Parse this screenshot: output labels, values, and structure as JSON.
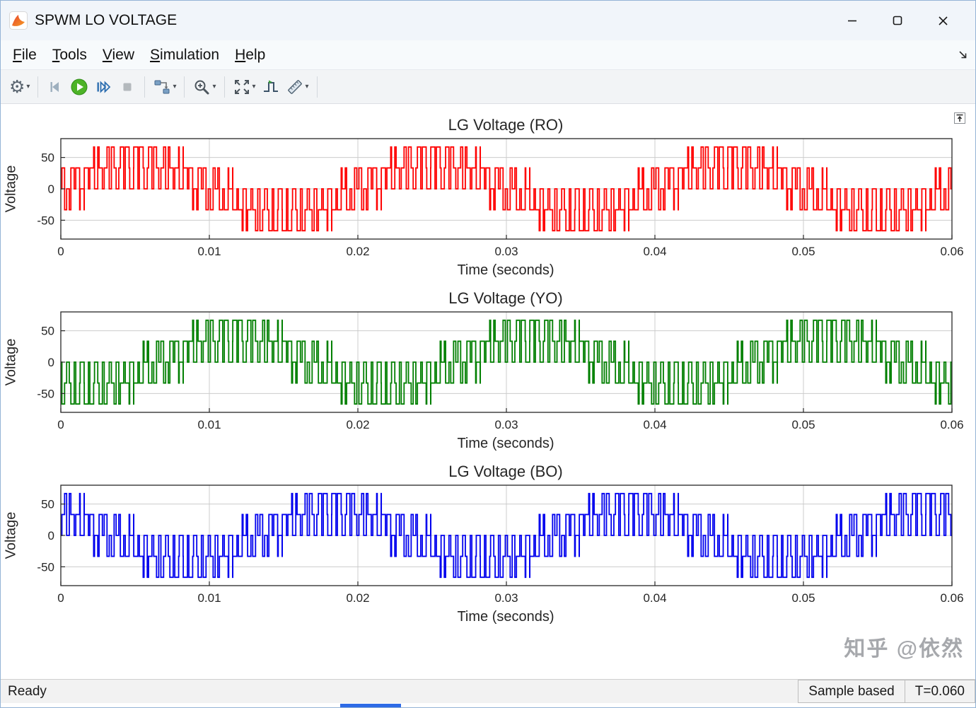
{
  "window": {
    "title": "SPWM LO VOLTAGE",
    "app_icon": "matlab-logo-icon",
    "controls": [
      "minimize",
      "maximize",
      "close"
    ]
  },
  "menu": {
    "items": [
      "File",
      "Tools",
      "View",
      "Simulation",
      "Help"
    ],
    "dock_arrow_icon": "dock-arrow-icon"
  },
  "toolbar": {
    "buttons": [
      {
        "name": "settings",
        "icon": "gear-icon",
        "dropdown": true
      },
      {
        "name": "step-back",
        "icon": "step-back-icon",
        "dropdown": false
      },
      {
        "name": "run",
        "icon": "run-icon",
        "dropdown": false
      },
      {
        "name": "step-forward",
        "icon": "step-forward-icon",
        "dropdown": false
      },
      {
        "name": "stop",
        "icon": "stop-icon",
        "dropdown": false
      },
      {
        "name": "simulink-blocks",
        "icon": "blocks-icon",
        "dropdown": true
      },
      {
        "name": "zoom",
        "icon": "zoom-icon",
        "dropdown": true
      },
      {
        "name": "fit-to-view",
        "icon": "fit-to-view-icon",
        "dropdown": true
      },
      {
        "name": "trigger",
        "icon": "trigger-icon",
        "dropdown": false
      },
      {
        "name": "measurements",
        "icon": "ruler-icon",
        "dropdown": true
      }
    ]
  },
  "canvas": {
    "expand_icon": "dock-up-icon"
  },
  "chart_data": [
    {
      "type": "line",
      "title": "LG Voltage (RO)",
      "xlabel": "Time (seconds)",
      "ylabel": "Voltage",
      "color": "#ff0000",
      "color_name": "red",
      "grid_color": "#cccccc",
      "grid": true,
      "xlim": [
        0,
        0.06
      ],
      "ylim": [
        -80,
        80
      ],
      "x_ticks": [
        0,
        0.01,
        0.02,
        0.03,
        0.04,
        0.05,
        0.06
      ],
      "x_tick_labels": [
        "0",
        "0.01",
        "0.02",
        "0.03",
        "0.04",
        "0.05",
        "0.06"
      ],
      "y_ticks": [
        -50,
        0,
        50
      ],
      "y_tick_labels": [
        "-50",
        "0",
        "50"
      ],
      "waveform": {
        "kind": "spwm_line_to_ground",
        "phase_deg": 0,
        "fundamental_hz": 50,
        "carrier_hz": 1050,
        "modulation_index": 0.8,
        "vdc": 100,
        "levels_volts": [
          -66.67,
          -33.33,
          0,
          33.33,
          66.67
        ]
      }
    },
    {
      "type": "line",
      "title": "LG Voltage (YO)",
      "xlabel": "Time (seconds)",
      "ylabel": "Voltage",
      "color": "#007f00",
      "color_name": "green",
      "grid_color": "#cccccc",
      "grid": true,
      "xlim": [
        0,
        0.06
      ],
      "ylim": [
        -80,
        80
      ],
      "x_ticks": [
        0,
        0.01,
        0.02,
        0.03,
        0.04,
        0.05,
        0.06
      ],
      "x_tick_labels": [
        "0",
        "0.01",
        "0.02",
        "0.03",
        "0.04",
        "0.05",
        "0.06"
      ],
      "y_ticks": [
        -50,
        0,
        50
      ],
      "y_tick_labels": [
        "-50",
        "0",
        "50"
      ],
      "waveform": {
        "kind": "spwm_line_to_ground",
        "phase_deg": -120,
        "fundamental_hz": 50,
        "carrier_hz": 1050,
        "modulation_index": 0.8,
        "vdc": 100,
        "levels_volts": [
          -66.67,
          -33.33,
          0,
          33.33,
          66.67
        ]
      }
    },
    {
      "type": "line",
      "title": "LG Voltage (BO)",
      "xlabel": "Time (seconds)",
      "ylabel": "Voltage",
      "color": "#0000ee",
      "color_name": "blue",
      "grid_color": "#cccccc",
      "grid": true,
      "xlim": [
        0,
        0.06
      ],
      "ylim": [
        -80,
        80
      ],
      "x_ticks": [
        0,
        0.01,
        0.02,
        0.03,
        0.04,
        0.05,
        0.06
      ],
      "x_tick_labels": [
        "0",
        "0.01",
        "0.02",
        "0.03",
        "0.04",
        "0.05",
        "0.06"
      ],
      "y_ticks": [
        -50,
        0,
        50
      ],
      "y_tick_labels": [
        "-50",
        "0",
        "50"
      ],
      "waveform": {
        "kind": "spwm_line_to_ground",
        "phase_deg": -240,
        "fundamental_hz": 50,
        "carrier_hz": 1050,
        "modulation_index": 0.8,
        "vdc": 100,
        "levels_volts": [
          -66.67,
          -33.33,
          0,
          33.33,
          66.67
        ]
      }
    }
  ],
  "status": {
    "left": "Ready",
    "sample_mode": "Sample based",
    "time": "T=0.060"
  },
  "watermark": {
    "text": "知乎 @依然"
  },
  "accent": {
    "bottom_bar_color": "#2e6be6"
  }
}
